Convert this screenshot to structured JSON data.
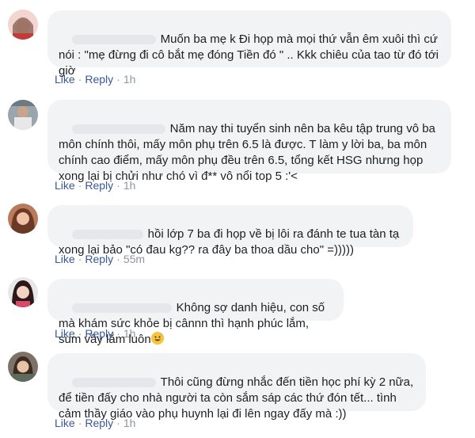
{
  "comments": [
    {
      "avatar": "avatar-1",
      "text": "Muốn ba mẹ k Đi họp mà mọi thứ vẫn êm xuôi thì cứ nói : \"mẹ đừng đi cô bắt mẹ đóng Tiền đó \" .. Kkk chiêu của tao từ đó tới giờ",
      "like": "Like",
      "reply": "Reply",
      "time": "1h"
    },
    {
      "avatar": "avatar-2",
      "text": "Năm nay thi tuyển sinh nên ba kêu tập trung vô ba môn chính thôi, mấy môn phụ trên 6.5 là được. T làm y lời ba, ba môn chính cao điểm, mấy môn phụ đều trên 6.5, tổng kết HSG nhưng họp xong lại bị chửi như chó vì đ** vô nổi top 5 :'<",
      "like": "Like",
      "reply": "Reply",
      "time": "1h"
    },
    {
      "avatar": "avatar-3",
      "text": "hồi lớp 7 ba đi họp về bị lôi ra đánh te tua tàn tạ xong lại bảo \"có đau kg?? ra đây ba thoa dầu cho\" =)))))",
      "like": "Like",
      "reply": "Reply",
      "time": "55m"
    },
    {
      "avatar": "avatar-4",
      "text": "Không sợ danh hiệu, con số mà khám sức khỏe bị cânnn thì hạnh phúc lắm, sum vầy lắm luôn",
      "emoji": "grinning-sweat-emoji",
      "like": "Like",
      "reply": "Reply",
      "time": "1h"
    },
    {
      "avatar": "avatar-5",
      "text": "Thôi cũng đừng nhắc đến tiền học phí kỳ 2 nữa, để tiền đấy cho nhà người ta còn sắm sáp các thứ đón tết... tình cảm thầy giáo vào phụ huynh lại đi lên ngay đấy mà :))",
      "like": "Like",
      "reply": "Reply",
      "time": "1h"
    }
  ],
  "separator": "·"
}
